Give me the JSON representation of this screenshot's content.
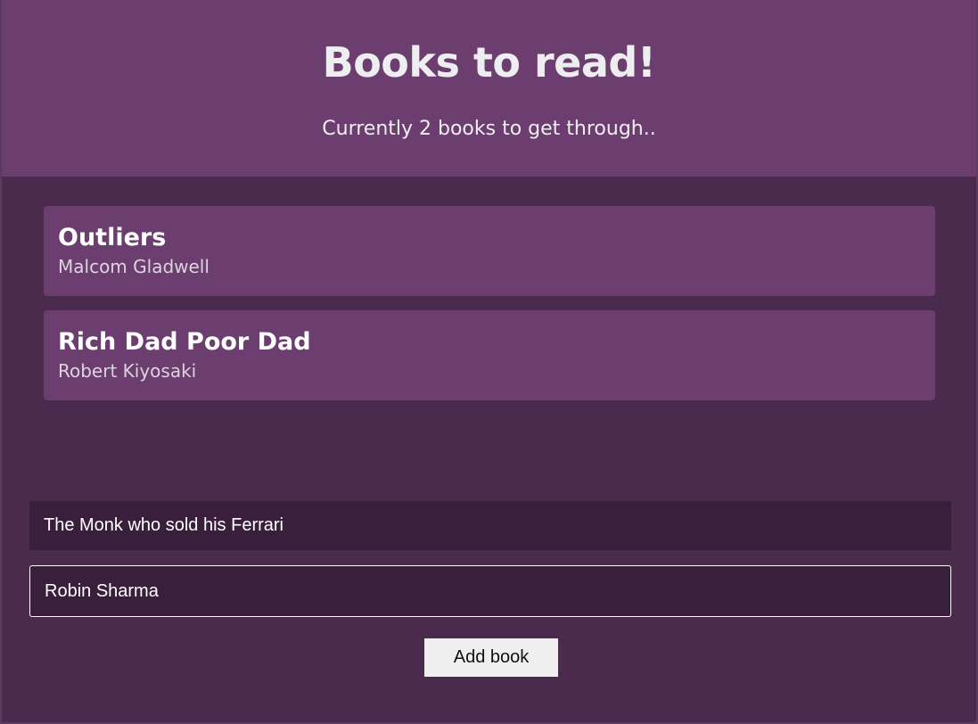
{
  "header": {
    "title": "Books to read!",
    "subtitle": "Currently 2 books to get through.."
  },
  "books": [
    {
      "title": "Outliers",
      "author": "Malcom Gladwell"
    },
    {
      "title": "Rich Dad Poor Dad",
      "author": "Robert Kiyosaki"
    }
  ],
  "form": {
    "title_value": "The Monk who sold his Ferrari",
    "author_value": "Robin Sharma",
    "submit_label": "Add book"
  },
  "colors": {
    "background": "#4a2a4d",
    "header_bg": "#6c3d6f",
    "card_bg": "#6c3d6f",
    "input_bg": "#3a1f3c"
  }
}
